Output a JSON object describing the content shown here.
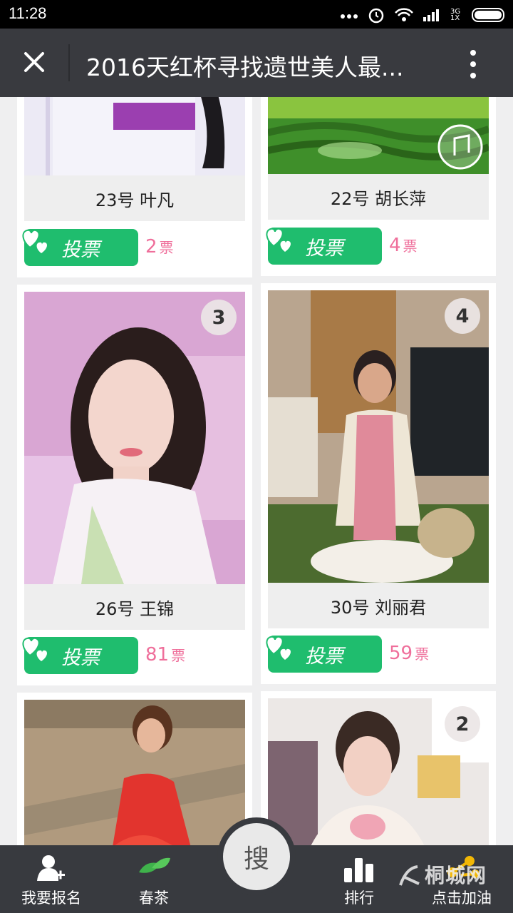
{
  "status": {
    "time": "11:28",
    "network": "3G 1X"
  },
  "header": {
    "title": "2016天红杯寻找遗世美人最..."
  },
  "cards": [
    {
      "name": "23号 叶凡",
      "vote_label": "投票",
      "votes": "2",
      "unit": "票"
    },
    {
      "name": "22号 胡长萍",
      "vote_label": "投票",
      "votes": "4",
      "unit": "票"
    },
    {
      "name": "26号 王锦",
      "vote_label": "投票",
      "votes": "81",
      "unit": "票",
      "rank": "3"
    },
    {
      "name": "30号 刘丽君",
      "vote_label": "投票",
      "votes": "59",
      "unit": "票",
      "rank": "4"
    },
    {
      "rank": "2"
    }
  ],
  "tabs": [
    {
      "label": "我要报名",
      "icon": "user-add-icon"
    },
    {
      "label": "春茶",
      "icon": "tea-leaf-icon"
    },
    {
      "label": "搜",
      "icon": "search"
    },
    {
      "label": "排行",
      "icon": "bar-chart-icon"
    },
    {
      "label": "点击加油",
      "icon": "share-icon"
    }
  ],
  "watermark": "桐城网",
  "colors": {
    "accent_green": "#1fbd6e",
    "vote_pink": "#ef6f9b",
    "titlebar": "#393a3f"
  }
}
